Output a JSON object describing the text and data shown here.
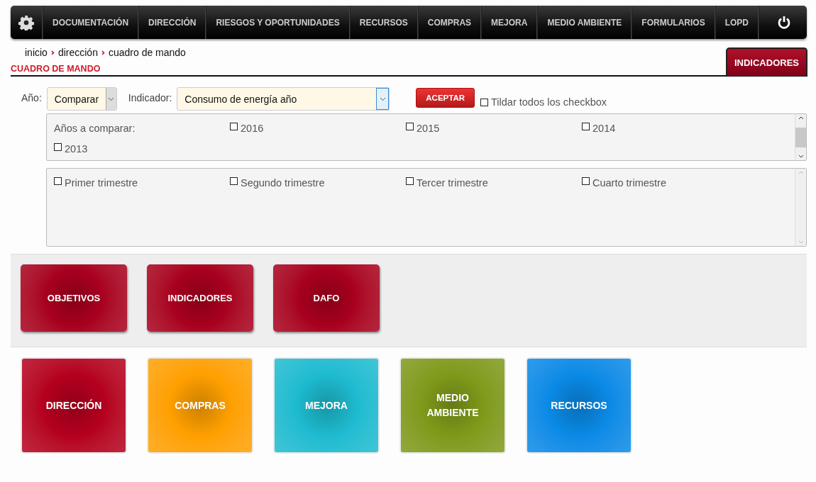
{
  "navbar": {
    "items": [
      {
        "label": "DOCUMENTACIÓN"
      },
      {
        "label": "DIRECCIÓN"
      },
      {
        "label": "RIESGOS Y OPORTUNIDADES"
      },
      {
        "label": "RECURSOS"
      },
      {
        "label": "COMPRAS"
      },
      {
        "label": "MEJORA"
      },
      {
        "label": "MEDIO AMBIENTE"
      },
      {
        "label": "FORMULARIOS"
      },
      {
        "label": "LOPD"
      }
    ]
  },
  "breadcrumb": [
    "inicio",
    "dirección",
    "cuadro de mando"
  ],
  "page_title": "CUADRO DE MANDO",
  "tab": {
    "label": "INDICADORES",
    "selected": true
  },
  "filters": {
    "year_label": "Año:",
    "year_value": "Comparar",
    "indicator_label": "Indicador:",
    "indicator_value": "Consumo de energía año",
    "accept_button": "ACEPTAR",
    "check_all": {
      "label": "Tildar todos los checkbox",
      "checked": false
    }
  },
  "years_panel": {
    "label": "Años a comparar:",
    "options": [
      {
        "label": "2016",
        "checked": false
      },
      {
        "label": "2015",
        "checked": false
      },
      {
        "label": "2014",
        "checked": false
      },
      {
        "label": "2013",
        "checked": false
      }
    ]
  },
  "quarters_panel": {
    "options": [
      {
        "label": "Primer trimestre",
        "checked": false
      },
      {
        "label": "Segundo trimestre",
        "checked": false
      },
      {
        "label": "Tercer trimestre",
        "checked": false
      },
      {
        "label": "Cuarto trimestre",
        "checked": false
      }
    ]
  },
  "section_tiles": [
    {
      "label": "OBJETIVOS",
      "color": "#a8001e"
    },
    {
      "label": "INDICADORES",
      "color": "#a8001e"
    },
    {
      "label": "DAFO",
      "color": "#a8001e"
    }
  ],
  "area_tiles": [
    {
      "label": "DIRECCIÓN",
      "color": "#b5001f"
    },
    {
      "label": "COMPRAS",
      "color": "#ffa000"
    },
    {
      "label": "MEJORA",
      "color": "#1ebbd0"
    },
    {
      "label": "MEDIO AMBIENTE",
      "color": "#7f9a1a"
    },
    {
      "label": "RECURSOS",
      "color": "#0a8ae6"
    }
  ]
}
